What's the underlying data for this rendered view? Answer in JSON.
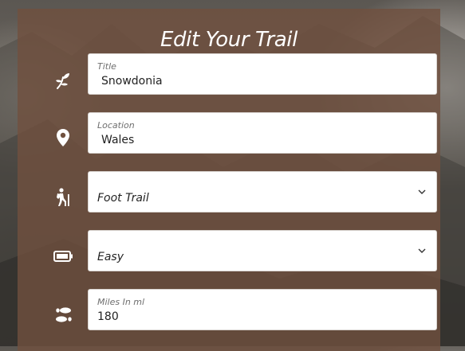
{
  "form": {
    "heading": "Edit Your Trail",
    "fields": [
      {
        "icon": "sprout-icon",
        "label": "Title",
        "value": "Snowdonia"
      },
      {
        "icon": "location-pin-icon",
        "label": "Location",
        "value": "Wales"
      },
      {
        "icon": "hiker-icon",
        "selected": "Foot Trail"
      },
      {
        "icon": "battery-icon",
        "selected": "Easy"
      },
      {
        "icon": "footprints-icon",
        "label": "Miles In ml",
        "value": "180"
      }
    ]
  },
  "colors": {
    "card_bg": "#70503e",
    "icon": "#ffffff",
    "field_bg": "#ffffff",
    "label_text": "#6e6e6e",
    "value_text": "#222222"
  }
}
